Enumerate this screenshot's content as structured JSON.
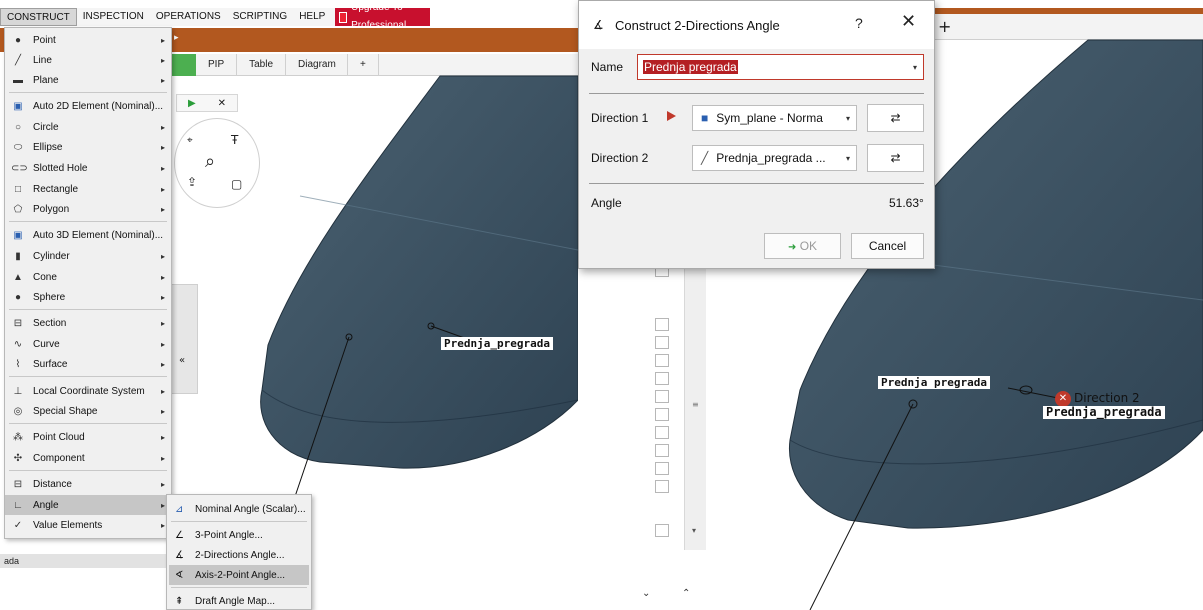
{
  "menubar": {
    "items": [
      "CONSTRUCT",
      "INSPECTION",
      "OPERATIONS",
      "SCRIPTING",
      "HELP"
    ],
    "upgrade_label": "Upgrade To Professional"
  },
  "construct_menu": {
    "items": [
      {
        "label": "Point",
        "icon": "point-icon",
        "submenu": true
      },
      {
        "label": "Line",
        "icon": "line-icon",
        "submenu": true
      },
      {
        "label": "Plane",
        "icon": "plane-icon",
        "submenu": true
      },
      {
        "label": "Auto 2D Element (Nominal)...",
        "icon": "auto-2d-icon",
        "submenu": false
      },
      {
        "label": "Circle",
        "icon": "circle-icon",
        "submenu": true
      },
      {
        "label": "Ellipse",
        "icon": "ellipse-icon",
        "submenu": true
      },
      {
        "label": "Slotted Hole",
        "icon": "slotted-hole-icon",
        "submenu": true
      },
      {
        "label": "Rectangle",
        "icon": "rectangle-icon",
        "submenu": true
      },
      {
        "label": "Polygon",
        "icon": "polygon-icon",
        "submenu": true
      },
      {
        "label": "Auto 3D Element (Nominal)...",
        "icon": "auto-3d-icon",
        "submenu": false
      },
      {
        "label": "Cylinder",
        "icon": "cylinder-icon",
        "submenu": true
      },
      {
        "label": "Cone",
        "icon": "cone-icon",
        "submenu": true
      },
      {
        "label": "Sphere",
        "icon": "sphere-icon",
        "submenu": true
      },
      {
        "label": "Section",
        "icon": "section-icon",
        "submenu": true
      },
      {
        "label": "Curve",
        "icon": "curve-icon",
        "submenu": true
      },
      {
        "label": "Surface",
        "icon": "surface-icon",
        "submenu": true
      },
      {
        "label": "Local Coordinate System",
        "icon": "coordinate-system-icon",
        "submenu": true
      },
      {
        "label": "Special Shape",
        "icon": "special-shape-icon",
        "submenu": true
      },
      {
        "label": "Point Cloud",
        "icon": "point-cloud-icon",
        "submenu": true
      },
      {
        "label": "Component",
        "icon": "component-icon",
        "submenu": true
      },
      {
        "label": "Distance",
        "icon": "distance-icon",
        "submenu": true
      },
      {
        "label": "Angle",
        "icon": "angle-icon",
        "submenu": true
      },
      {
        "label": "Value Elements",
        "icon": "value-elements-icon",
        "submenu": true
      }
    ]
  },
  "angle_submenu": {
    "items": [
      {
        "label": "Nominal Angle (Scalar)...",
        "icon": "nominal-angle-icon"
      },
      {
        "label": "3-Point Angle...",
        "icon": "three-point-angle-icon"
      },
      {
        "label": "2-Directions Angle...",
        "icon": "two-directions-angle-icon"
      },
      {
        "label": "Axis-2-Point Angle...",
        "icon": "axis-two-point-angle-icon"
      },
      {
        "label": "Draft Angle Map...",
        "icon": "draft-angle-map-icon"
      }
    ]
  },
  "left_view": {
    "tabs": [
      "PIP",
      "Table",
      "Diagram",
      "+"
    ],
    "label_3d": "Prednja_pregrada",
    "bottom_text": "ada",
    "collapse_glyph": "«"
  },
  "dialog": {
    "title": "Construct 2-Directions Angle",
    "help": "?",
    "close": "✕",
    "name_label": "Name",
    "name_value": "Prednja pregrada",
    "direction1_label": "Direction 1",
    "direction1_value": "Sym_plane - Norma",
    "direction2_label": "Direction 2",
    "direction2_value": "Prednja_pregrada ...",
    "angle_label": "Angle",
    "angle_value": "51.63°",
    "ok_label": "OK",
    "cancel_label": "Cancel",
    "swap_glyph": "⇄"
  },
  "right_view": {
    "tab_plus": "+",
    "label_pregrada": "Prednja pregrada",
    "label_direction2": "Direction 2",
    "label_pregrada_2": "Prednja_pregrada"
  },
  "colors": {
    "accent_orange": "#b2581f",
    "upgrade_red": "#c8102e",
    "model_fill": "#3f5566",
    "selection_red": "#b41f23"
  }
}
